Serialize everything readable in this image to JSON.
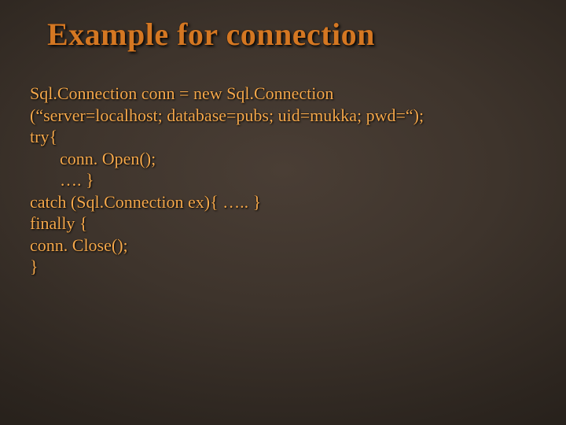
{
  "title": "Example for connection",
  "code": {
    "l1": "Sql.Connection conn = new Sql.Connection",
    "l2": "(“server=localhost; database=pubs; uid=mukka; pwd=“);",
    "l3": "try{",
    "l4": "conn. Open();",
    "l5": "…. }",
    "l6": "catch (Sql.Connection ex){ ….. }",
    "l7": "finally {",
    "l8": "conn. Close();",
    "l9": "}"
  }
}
